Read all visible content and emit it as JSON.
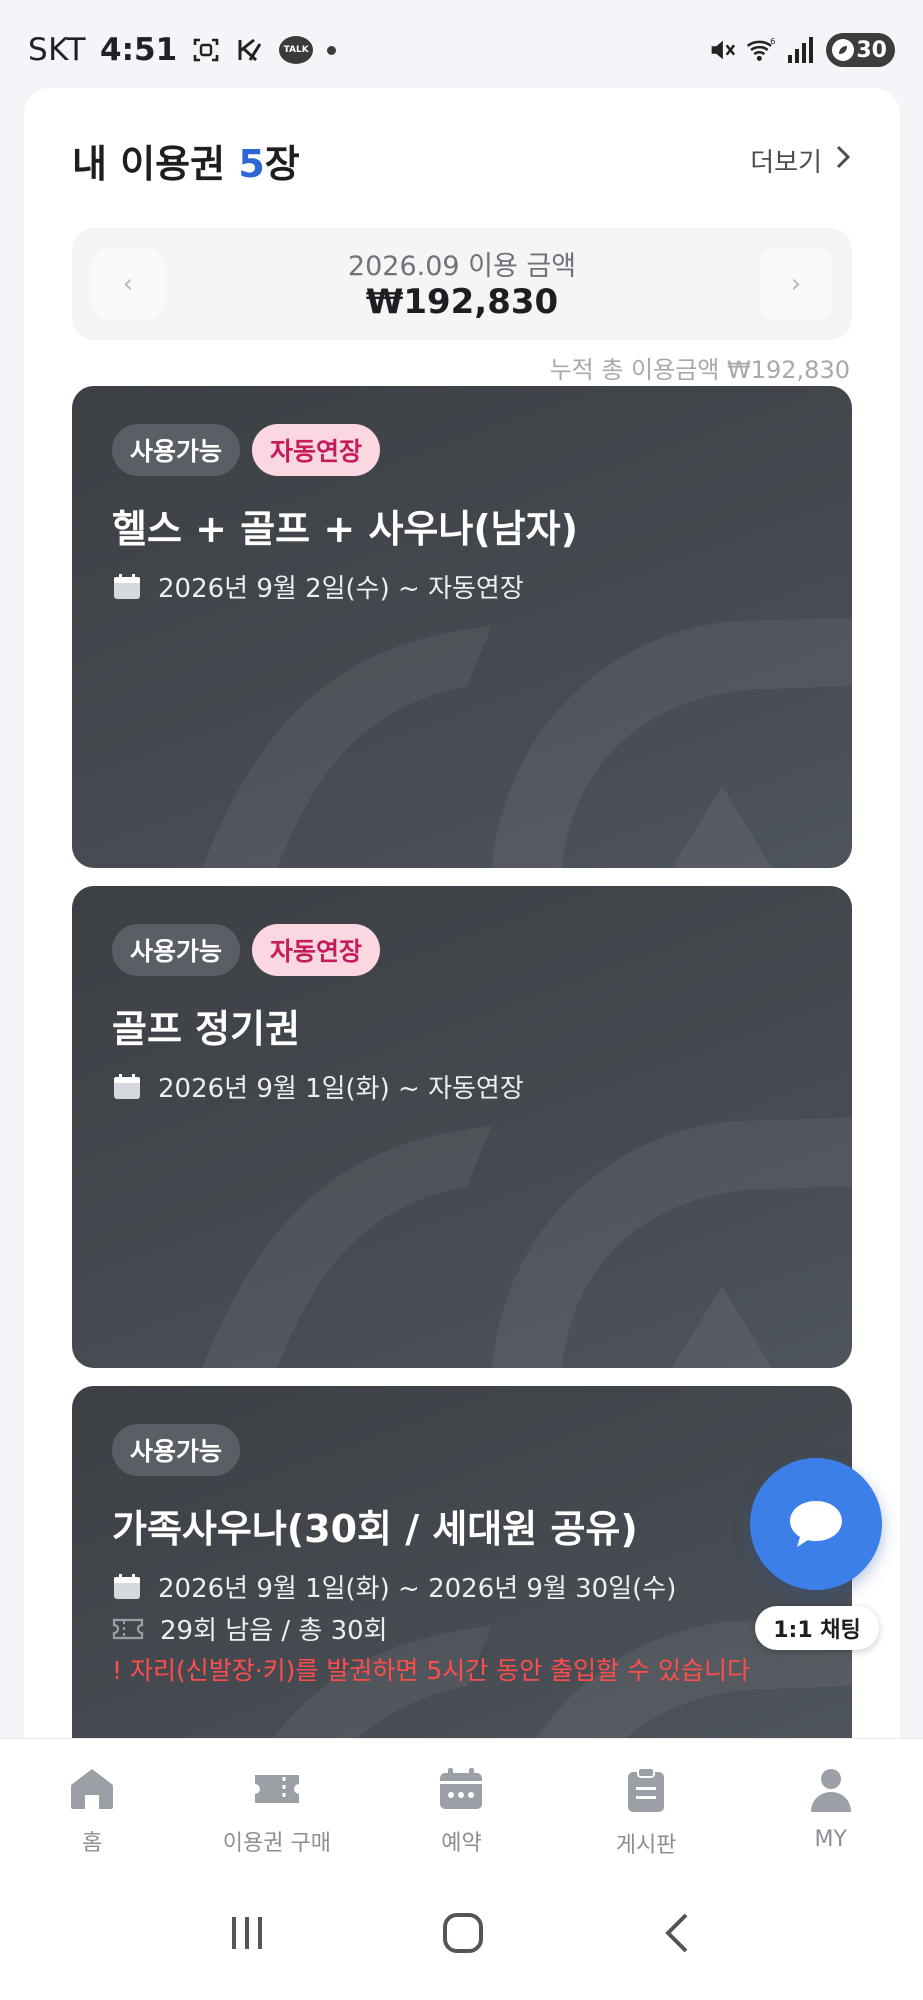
{
  "status_bar": {
    "carrier": "SKT",
    "time": "4:51",
    "talk_icon_text": "TALK",
    "battery": "30",
    "icons": [
      "screenshot-icon",
      "k-app-icon",
      "kakaotalk-icon",
      "dot-icon",
      "mute-icon",
      "wifi-icon",
      "signal-icon",
      "battery-icon"
    ]
  },
  "header": {
    "title_prefix": "내 이용권 ",
    "count": "5",
    "title_suffix": "장",
    "more_label": "더보기"
  },
  "usage": {
    "month_label": "2026.09 이용 금액",
    "amount": "₩192,830",
    "prev_arrow": "‹",
    "next_arrow": "›",
    "cumulative": "누적 총 이용금액 ₩192,830"
  },
  "tickets": [
    {
      "badges": [
        "사용가능",
        "자동연장"
      ],
      "title": "헬스 + 골프 + 사우나(남자)",
      "period": "2026년 9월 2일(수) ~ 자동연장"
    },
    {
      "badges": [
        "사용가능",
        "자동연장"
      ],
      "title": "골프 정기권",
      "period": "2026년 9월 1일(화) ~ 자동연장"
    },
    {
      "badges": [
        "사용가능"
      ],
      "title": "가족사우나(30회 / 세대원 공유)",
      "period": "2026년 9월 1일(화) ~ 2026년 9월 30일(수)",
      "remaining": "29회 남음 / 총 30회",
      "warning": "! 자리(신발장·키)를 발권하면 5시간 동안 출입할 수 있습니다"
    }
  ],
  "chat": {
    "label": "1:1 채팅"
  },
  "nav": [
    {
      "label": "홈",
      "icon": "home-icon"
    },
    {
      "label": "이용권 구매",
      "icon": "ticket-icon"
    },
    {
      "label": "예약",
      "icon": "calendar-icon"
    },
    {
      "label": "게시판",
      "icon": "clipboard-icon"
    },
    {
      "label": "MY",
      "icon": "person-icon"
    }
  ],
  "system_nav": [
    "recent-apps-icon",
    "home-circle-icon",
    "back-icon"
  ],
  "colors": {
    "accent": "#2f66d6",
    "auto_badge_bg": "#fbd7e2",
    "auto_badge_text": "#c41d5a",
    "card_bg": "#43484e",
    "warning": "#ff4d4d",
    "chat_fab": "#3d7fe8"
  }
}
